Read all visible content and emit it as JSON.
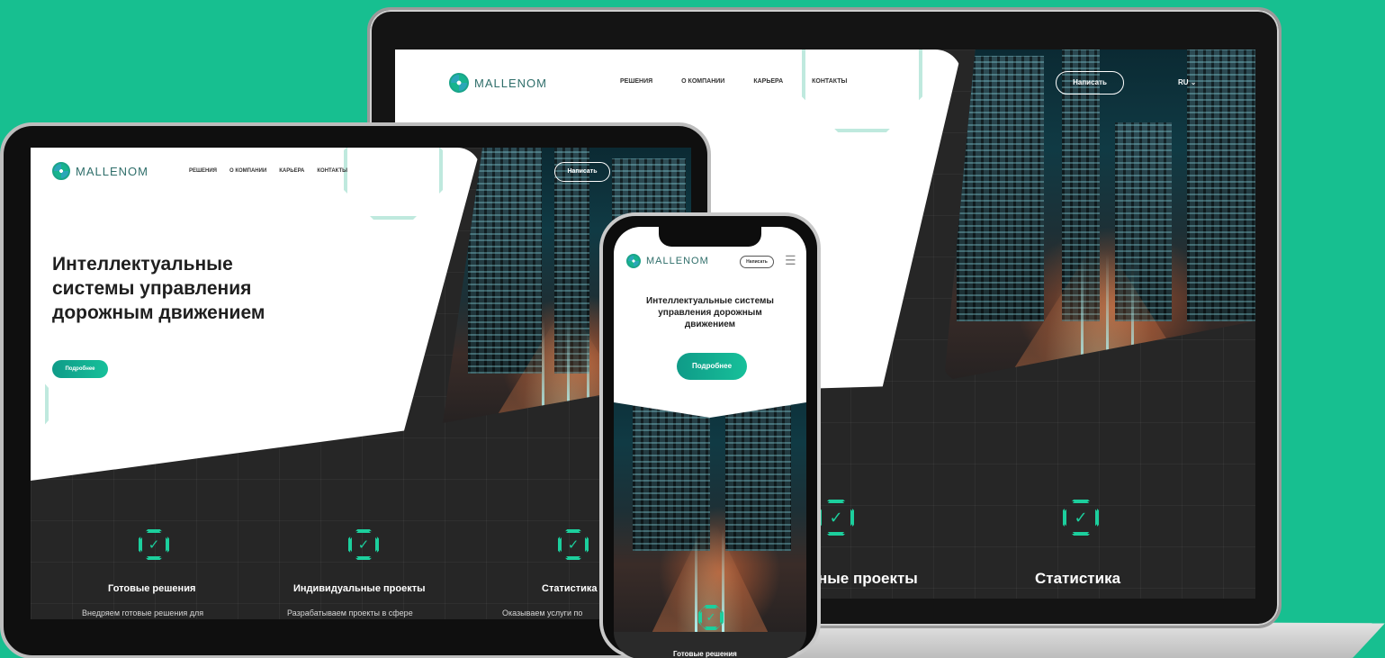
{
  "brand": {
    "logo_text": "MALLENOM"
  },
  "nav": {
    "items": [
      "РЕШЕНИЯ",
      "О КОМПАНИИ",
      "КАРЬЕРА",
      "КОНТАКТЫ"
    ]
  },
  "header": {
    "write_button": "Написать",
    "lang": "RU ⌄"
  },
  "hero": {
    "title_line1": "Интеллектуальные",
    "title_line2": "системы управления",
    "title_line3": "дорожным движением",
    "mobile_title": "Интеллектуальные системы управления дорожным движением",
    "more_button": "Подробнее"
  },
  "features": [
    {
      "title": "Готовые решения",
      "desc": "Внедряем готовые решения для"
    },
    {
      "title": "Индивидуальные проекты",
      "desc": "Разрабатываем проекты в сфере"
    },
    {
      "title": "Статистика",
      "desc": "Оказываем услуги по"
    }
  ],
  "laptop_features": {
    "title_partial": "ные проекты",
    "stats_title": "Статистика"
  },
  "phone": {
    "bottom_partial": "Готовые решения"
  },
  "icons": {
    "feature": "check-octagon-icon",
    "menu": "hamburger-icon",
    "logo": "mallenom-logo-icon"
  },
  "colors": {
    "background": "#17bf90",
    "accent": "#1ccf9d",
    "dark": "#262626"
  }
}
